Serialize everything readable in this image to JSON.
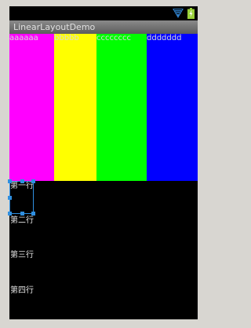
{
  "status_bar": {
    "icons": [
      "wifi-icon",
      "battery-charging-icon"
    ]
  },
  "app": {
    "title": "LinearLayoutDemo"
  },
  "stripes": [
    {
      "label": "aaaaaa",
      "color": "#ff00ff"
    },
    {
      "label": "bbbbb",
      "color": "#ffff00"
    },
    {
      "label": "cccccccc",
      "color": "#00ff00"
    },
    {
      "label": "ddddddd",
      "color": "#0000ff"
    }
  ],
  "rows": [
    {
      "label": "第一行"
    },
    {
      "label": "第二行"
    },
    {
      "label": "第三行"
    },
    {
      "label": "第四行"
    }
  ],
  "colors": {
    "selection": "#2f8fe0",
    "background": "#000000"
  }
}
